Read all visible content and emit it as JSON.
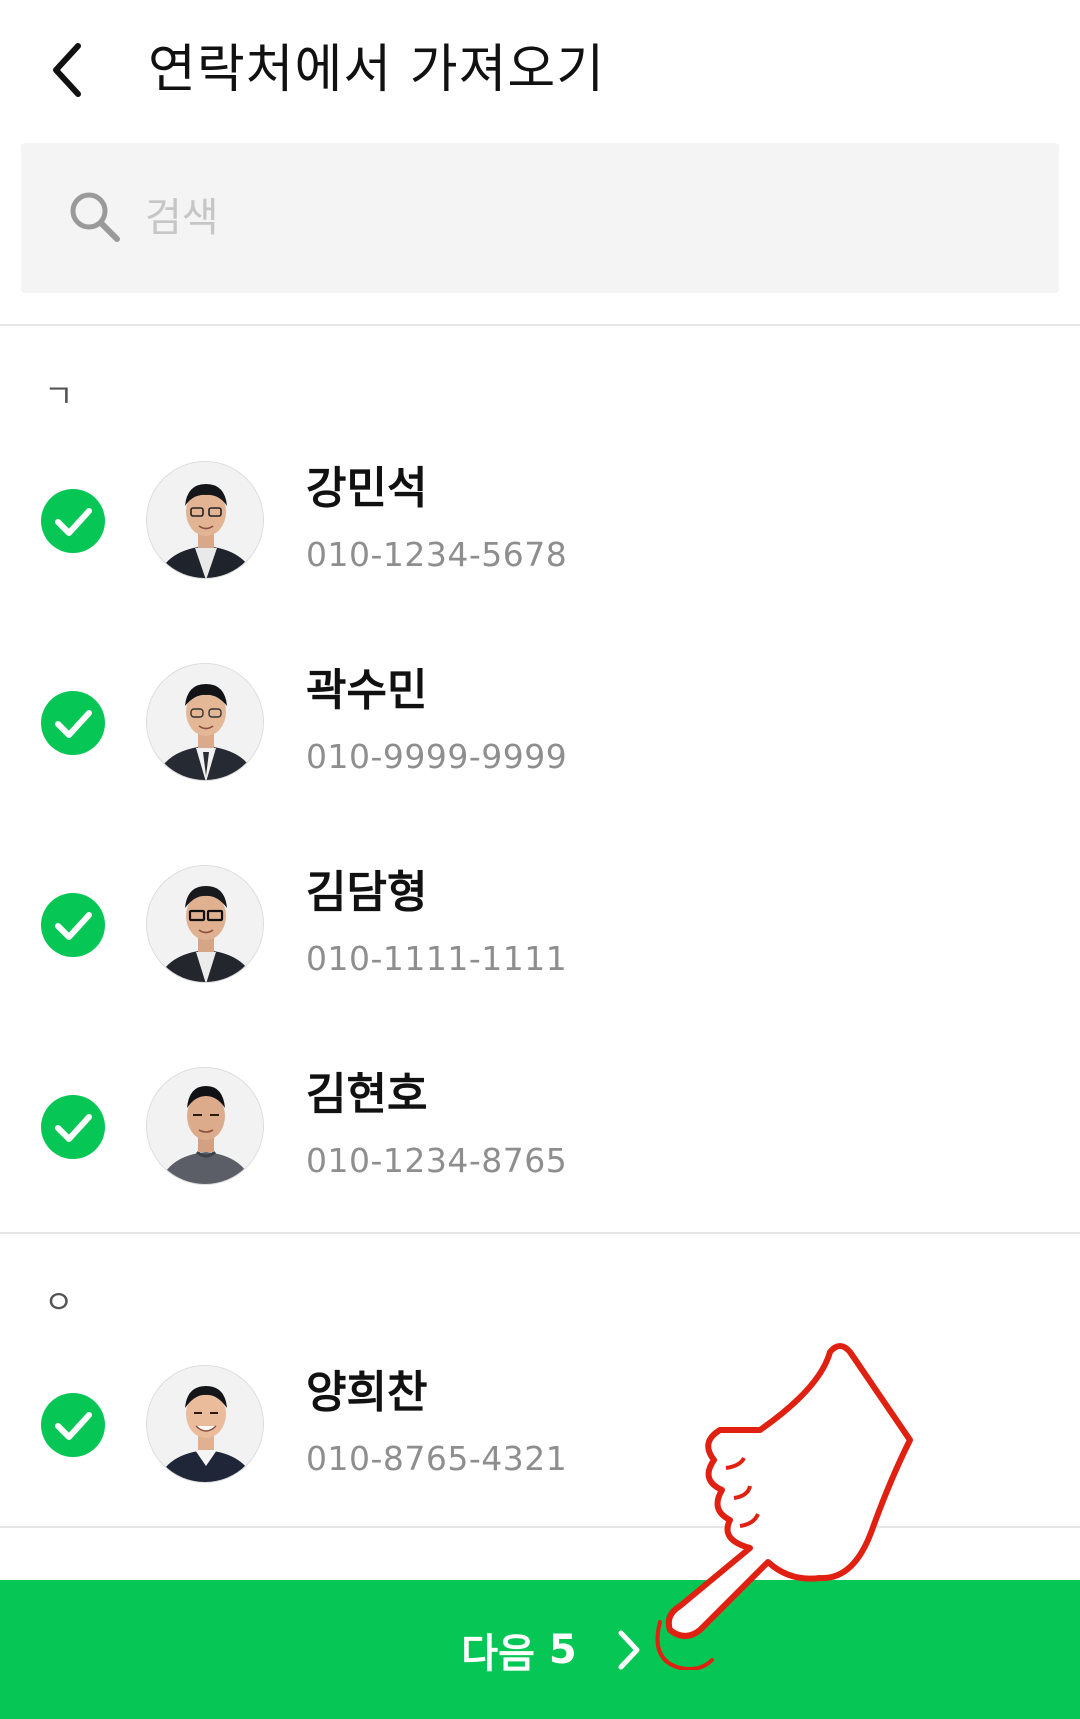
{
  "header": {
    "title": "연락처에서 가져오기",
    "back_icon": "back-arrow-icon"
  },
  "search": {
    "placeholder": "검색",
    "value": "",
    "icon": "search-icon"
  },
  "sections": [
    {
      "letter": "ㄱ",
      "contacts": [
        {
          "name": "강민석",
          "phone": "010-1234-5678",
          "selected": true
        },
        {
          "name": "곽수민",
          "phone": "010-9999-9999",
          "selected": true
        },
        {
          "name": "김담형",
          "phone": "010-1111-1111",
          "selected": true
        },
        {
          "name": "김현호",
          "phone": "010-1234-8765",
          "selected": true
        }
      ]
    },
    {
      "letter": "ㅇ",
      "contacts": [
        {
          "name": "양희찬",
          "phone": "010-8765-4321",
          "selected": true
        }
      ]
    }
  ],
  "next_button": {
    "label": "다음",
    "count": "5",
    "icon": "chevron-right-icon"
  },
  "colors": {
    "accent": "#06c755",
    "annotation": "#e02010"
  }
}
